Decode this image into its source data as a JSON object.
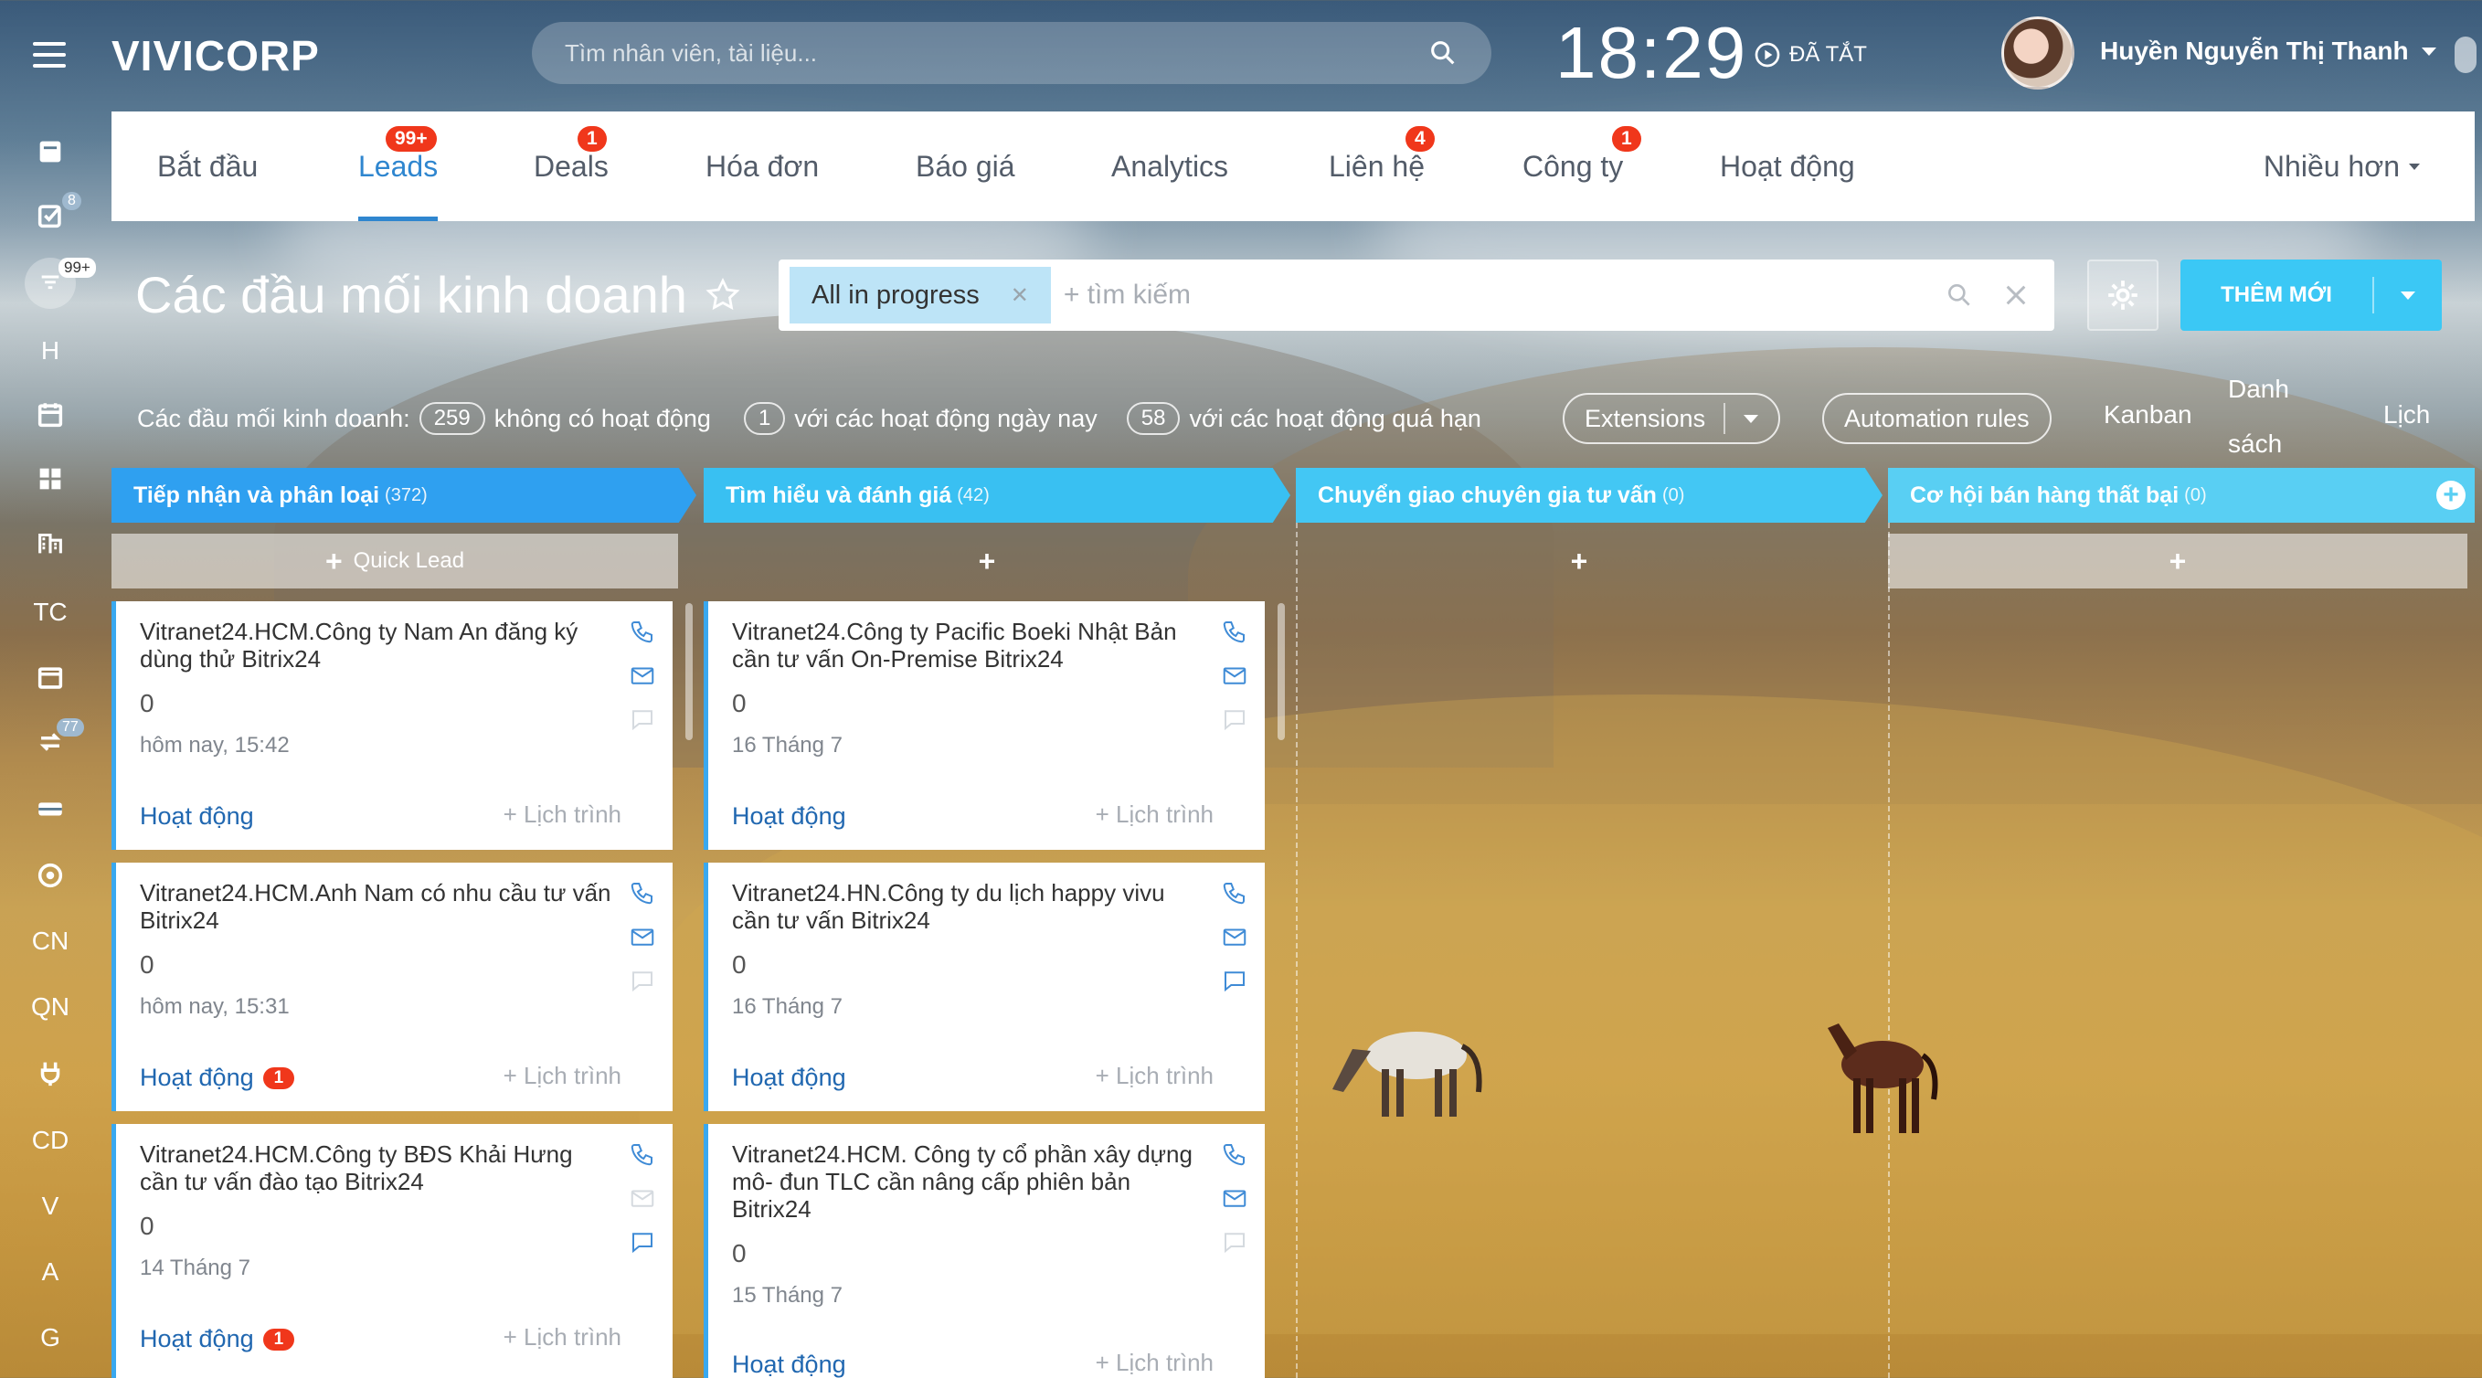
{
  "header": {
    "logo": "VIVICORP",
    "search_placeholder": "Tìm nhân viên, tài liệu...",
    "clock": "18:29",
    "status": "ĐÃ TẮT",
    "user_name": "Huyền Nguyễn Thị Thanh"
  },
  "rail": {
    "badges": {
      "tasks": "8",
      "feed": "99+",
      "sync": "77"
    },
    "letters": [
      "H",
      "TC",
      "CN",
      "QN",
      "CD",
      "V",
      "A",
      "G"
    ]
  },
  "tabs": [
    {
      "label": "Bắt đầu",
      "badge": ""
    },
    {
      "label": "Leads",
      "badge": "99+"
    },
    {
      "label": "Deals",
      "badge": "1"
    },
    {
      "label": "Hóa đơn",
      "badge": ""
    },
    {
      "label": "Báo giá",
      "badge": ""
    },
    {
      "label": "Analytics",
      "badge": ""
    },
    {
      "label": "Liên hệ",
      "badge": "4"
    },
    {
      "label": "Công ty",
      "badge": "1"
    },
    {
      "label": "Hoạt động",
      "badge": ""
    }
  ],
  "more_label": "Nhiều hơn",
  "page": {
    "title": "Các đầu mối kinh doanh",
    "filter_chip": "All in progress",
    "filter_placeholder": "+ tìm kiếm",
    "add_button": "THÊM MỚI"
  },
  "stats": {
    "prefix": "Các đầu mối kinh doanh:",
    "total": "259",
    "no_activity_label": "không có hoạt động",
    "today_count": "1",
    "today_label": "với các hoạt động ngày nay",
    "overdue_count": "58",
    "overdue_label": "với các hoạt động quá hạn"
  },
  "toolbar": {
    "extensions": "Extensions",
    "automation": "Automation rules",
    "kanban": "Kanban",
    "list_line1": "Danh",
    "list_line2": "sách",
    "calendar": "Lịch"
  },
  "columns": [
    {
      "name": "Tiếp nhận và phân loại",
      "count": "(372)",
      "color": "#2fa0f0",
      "plus_label": "Quick Lead"
    },
    {
      "name": "Tìm hiểu và đánh giá",
      "count": "(42)",
      "color": "#39c0f2",
      "plus_label": ""
    },
    {
      "name": "Chuyển giao chuyên gia tư vấn",
      "count": "(0)",
      "color": "#43c7f4",
      "plus_label": ""
    },
    {
      "name": "Cơ hội bán hàng thất bại",
      "count": "(0)",
      "color": "#59cff3",
      "plus_label": ""
    }
  ],
  "cards": {
    "col1": [
      {
        "title": "Vitranet24.HCM.Công ty Nam An đăng ký dùng thử Bitrix24",
        "amount": "0",
        "date": "hôm nay, 15:42",
        "activity": "Hoạt động",
        "activity_badge": "",
        "schedule": "+ Lịch trình"
      },
      {
        "title": "Vitranet24.HCM.Anh Nam có nhu cầu tư vấn Bitrix24",
        "amount": "0",
        "date": "hôm nay, 15:31",
        "activity": "Hoạt động",
        "activity_badge": "1",
        "schedule": "+ Lịch trình"
      },
      {
        "title": "Vitranet24.HCM.Công ty BĐS Khải Hưng cần tư vấn đào tạo Bitrix24",
        "amount": "0",
        "date": "14 Tháng 7",
        "activity": "Hoạt động",
        "activity_badge": "1",
        "schedule": "+ Lịch trình"
      }
    ],
    "col2": [
      {
        "title": "Vitranet24.Công ty Pacific Boeki Nhật Bản cần tư vấn On-Premise Bitrix24",
        "amount": "0",
        "date": "16 Tháng 7",
        "activity": "Hoạt động",
        "activity_badge": "",
        "schedule": "+ Lịch trình"
      },
      {
        "title": "Vitranet24.HN.Công ty du lịch happy vivu cần tư vấn Bitrix24",
        "amount": "0",
        "date": "16 Tháng 7",
        "activity": "Hoạt động",
        "activity_badge": "",
        "schedule": "+ Lịch trình"
      },
      {
        "title": "Vitranet24.HCM. Công ty cổ phần xây dựng mô- đun TLC cần nâng cấp phiên bản Bitrix24",
        "amount": "0",
        "date": "15 Tháng 7",
        "activity": "Hoạt động",
        "activity_badge": "",
        "schedule": "+ Lịch trình"
      }
    ]
  }
}
